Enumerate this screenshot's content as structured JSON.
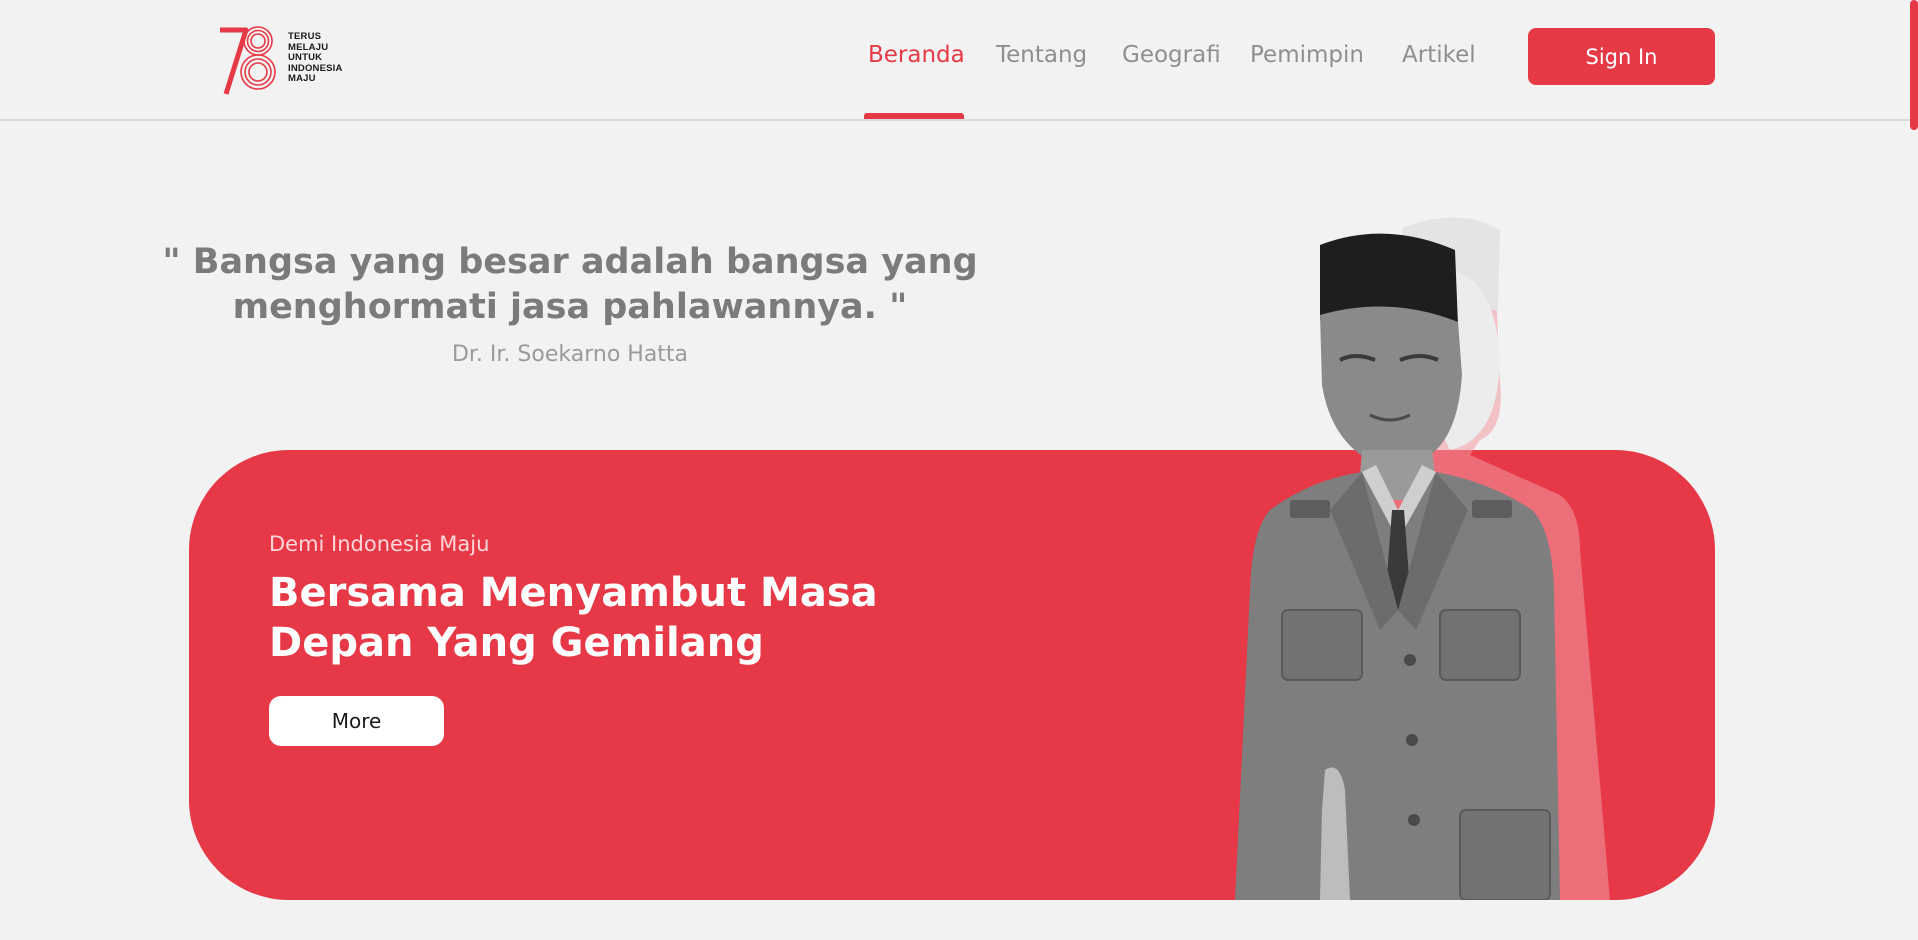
{
  "header": {
    "logo": {
      "number": "78",
      "tagline": [
        "TERUS",
        "MELAJU",
        "UNTUK",
        "INDONESIA",
        "MAJU"
      ],
      "icon": "anniversary-78-logo"
    },
    "nav": [
      {
        "label": "Beranda",
        "active": true
      },
      {
        "label": "Tentang",
        "active": false
      },
      {
        "label": "Geografi",
        "active": false
      },
      {
        "label": "Pemimpin",
        "active": false
      },
      {
        "label": "Artikel",
        "active": false
      }
    ],
    "signin_label": "Sign In"
  },
  "quote": {
    "line1": "\" Bangsa yang besar adalah bangsa yang",
    "line2": "menghormati jasa pahlawannya. \"",
    "author": "Dr. Ir. Soekarno Hatta"
  },
  "hero": {
    "kicker": "Demi Indonesia Maju",
    "title_line1": "Bersama Menyambut Masa",
    "title_line2": "Depan Yang Gemilang",
    "more_label": "More",
    "portrait": "black-and-white portrait of a man in uniform and peci cap with red shadow duplicate"
  },
  "colors": {
    "accent": "#e63946",
    "background": "#f3f2f2",
    "text_muted": "#8f8f8f"
  }
}
